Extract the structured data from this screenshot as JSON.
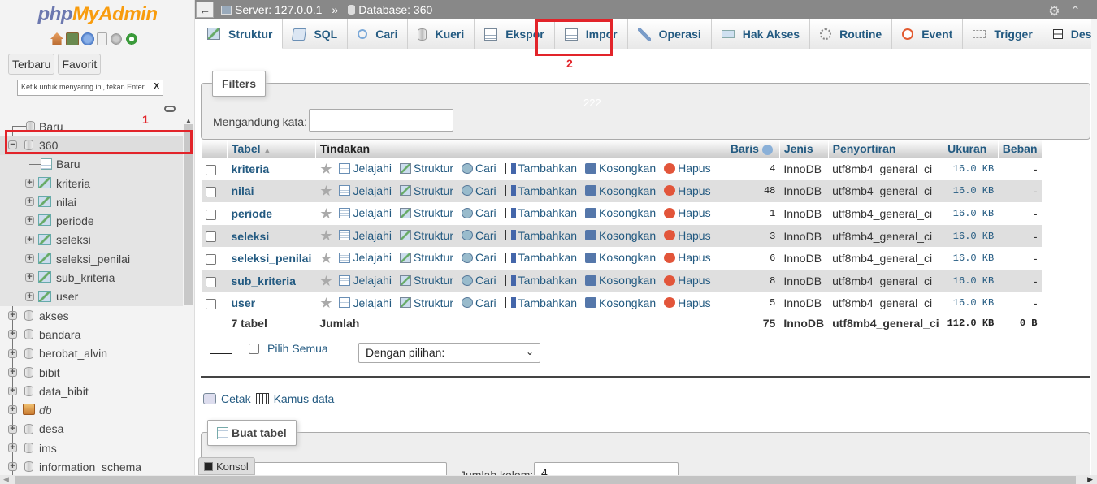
{
  "sidebar": {
    "logo_php": "php",
    "logo_myadmin": "MyAdmin",
    "quick_icons": [
      "home-icon",
      "logout-icon",
      "help-icon",
      "docs-icon",
      "settings-icon",
      "reload-icon"
    ],
    "tabs": [
      "Terbaru",
      "Favorit"
    ],
    "filter_placeholder": "Ketik untuk menyaring ini, tekan Enter",
    "filter_clear": "X",
    "tree": [
      {
        "label": "Baru",
        "type": "new-db"
      },
      {
        "label": "360",
        "type": "db",
        "expanded": true,
        "selected": true,
        "children": [
          {
            "label": "Baru",
            "type": "new-table"
          },
          {
            "label": "kriteria",
            "type": "table"
          },
          {
            "label": "nilai",
            "type": "table"
          },
          {
            "label": "periode",
            "type": "table"
          },
          {
            "label": "seleksi",
            "type": "table"
          },
          {
            "label": "seleksi_penilai",
            "type": "table"
          },
          {
            "label": "sub_kriteria",
            "type": "table"
          },
          {
            "label": "user",
            "type": "table"
          }
        ]
      },
      {
        "label": "akses",
        "type": "db"
      },
      {
        "label": "bandara",
        "type": "db"
      },
      {
        "label": "berobat_alvin",
        "type": "db"
      },
      {
        "label": "bibit",
        "type": "db"
      },
      {
        "label": "data_bibit",
        "type": "db"
      },
      {
        "label": "db",
        "type": "db-special"
      },
      {
        "label": "desa",
        "type": "db"
      },
      {
        "label": "ims",
        "type": "db"
      },
      {
        "label": "information_schema",
        "type": "db"
      }
    ]
  },
  "annotations": {
    "one": "1",
    "two": "2",
    "color": "#e2242a"
  },
  "breadcrumb": {
    "server": "Server: 127.0.0.1",
    "separator": "»",
    "database": "Database: 360",
    "back": "←"
  },
  "top_right": {
    "settings": "⚙",
    "collapse": "⌃"
  },
  "tabs": [
    {
      "label": "Struktur",
      "icon": "struct",
      "active": true
    },
    {
      "label": "SQL",
      "icon": "sql"
    },
    {
      "label": "Cari",
      "icon": "search"
    },
    {
      "label": "Kueri",
      "icon": "query"
    },
    {
      "label": "Ekspor",
      "icon": "export"
    },
    {
      "label": "Impor",
      "icon": "import"
    },
    {
      "label": "Operasi",
      "icon": "ops"
    },
    {
      "label": "Hak Akses",
      "icon": "priv"
    },
    {
      "label": "Routine",
      "icon": "routine"
    },
    {
      "label": "Event",
      "icon": "event"
    },
    {
      "label": "Trigger",
      "icon": "trigger"
    },
    {
      "label": "Desainer",
      "icon": "designer"
    }
  ],
  "filters": {
    "legend": "Filters",
    "label": "Mengandung kata:",
    "value": "",
    "faint_text": "222"
  },
  "table": {
    "headers": {
      "tabel": "Tabel",
      "tindakan": "Tindakan",
      "baris": "Baris",
      "jenis": "Jenis",
      "penyortiran": "Penyortiran",
      "ukuran": "Ukuran",
      "beban": "Beban"
    },
    "actions": {
      "browse": "Jelajahi",
      "structure": "Struktur",
      "search": "Cari",
      "insert": "Tambahkan",
      "empty": "Kosongkan",
      "drop": "Hapus"
    },
    "rows": [
      {
        "name": "kriteria",
        "rows": "4",
        "engine": "InnoDB",
        "collation": "utf8mb4_general_ci",
        "size": "16.0 KB",
        "overhead": "-"
      },
      {
        "name": "nilai",
        "rows": "48",
        "engine": "InnoDB",
        "collation": "utf8mb4_general_ci",
        "size": "16.0 KB",
        "overhead": "-"
      },
      {
        "name": "periode",
        "rows": "1",
        "engine": "InnoDB",
        "collation": "utf8mb4_general_ci",
        "size": "16.0 KB",
        "overhead": "-"
      },
      {
        "name": "seleksi",
        "rows": "3",
        "engine": "InnoDB",
        "collation": "utf8mb4_general_ci",
        "size": "16.0 KB",
        "overhead": "-"
      },
      {
        "name": "seleksi_penilai",
        "rows": "6",
        "engine": "InnoDB",
        "collation": "utf8mb4_general_ci",
        "size": "16.0 KB",
        "overhead": "-"
      },
      {
        "name": "sub_kriteria",
        "rows": "8",
        "engine": "InnoDB",
        "collation": "utf8mb4_general_ci",
        "size": "16.0 KB",
        "overhead": "-"
      },
      {
        "name": "user",
        "rows": "5",
        "engine": "InnoDB",
        "collation": "utf8mb4_general_ci",
        "size": "16.0 KB",
        "overhead": "-"
      }
    ],
    "footer": {
      "count": "7 tabel",
      "label": "Jumlah",
      "rows": "75",
      "engine": "InnoDB",
      "collation": "utf8mb4_general_ci",
      "size": "112.0 KB",
      "overhead": "0 B"
    }
  },
  "bulk": {
    "select_all": "Pilih Semua",
    "with_selected": "Dengan pilihan:"
  },
  "links": {
    "print": "Cetak",
    "dictionary": "Kamus data"
  },
  "create_table": {
    "legend": "Buat tabel",
    "name_value": "",
    "columns_label": "Jumlah kolom:",
    "columns_value": "4"
  },
  "console": {
    "label": "Konsol"
  }
}
